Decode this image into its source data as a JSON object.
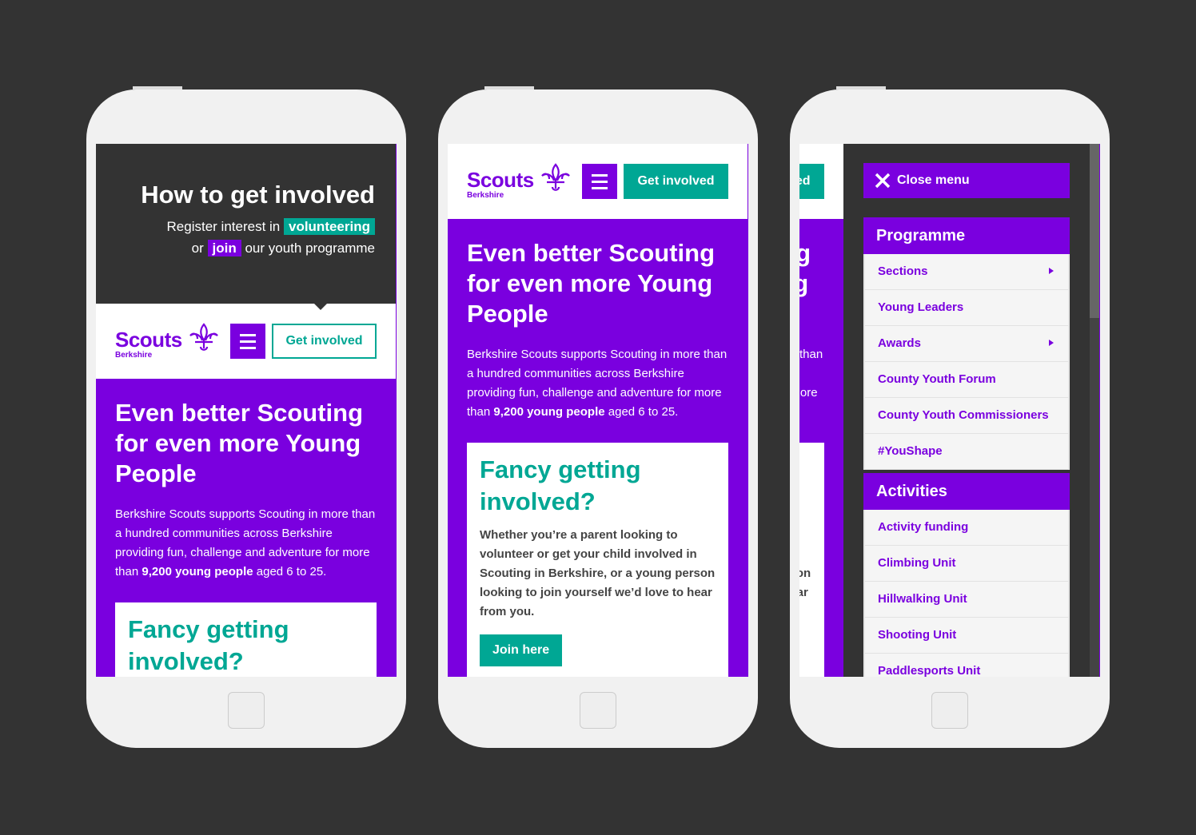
{
  "colors": {
    "purple": "#7a00df",
    "teal": "#00a794",
    "background": "#333333"
  },
  "intro": {
    "title": "How to get involved",
    "line1_prefix": "Register interest in",
    "volunteering": "volunteering",
    "or": "or",
    "join": "join",
    "line2_suffix": "our youth programme"
  },
  "header": {
    "logo_word": "Scouts",
    "logo_sub": "Berkshire",
    "logo_icon": "fleur-de-lis-icon",
    "menu_icon": "hamburger-icon",
    "cta": "Get involved"
  },
  "hero": {
    "title": "Even better Scouting for even more Young People",
    "text_before": "Berkshire Scouts supports Scouting in more than a hundred communities across Berkshire providing fun, challenge and adventure for more than ",
    "text_bold": "9,200 young people",
    "text_after": " aged 6 to 25."
  },
  "card": {
    "title": "Fancy getting involved?",
    "text": "Whether you’re a parent looking to volunteer or get your child involved in Scouting in Berkshire, or a young person looking to join yourself we’d love to hear from you.",
    "button": "Join here"
  },
  "menu": {
    "close": "Close menu",
    "sections": [
      {
        "title": "Programme",
        "items": [
          {
            "label": "Sections",
            "sub": true
          },
          {
            "label": "Young Leaders"
          },
          {
            "label": "Awards",
            "sub": true
          },
          {
            "label": "County Youth Forum"
          },
          {
            "label": "County Youth Commissioners"
          },
          {
            "label": "#YouShape"
          }
        ]
      },
      {
        "title": "Activities",
        "items": [
          {
            "label": "Activity funding"
          },
          {
            "label": "Climbing Unit"
          },
          {
            "label": "Hillwalking Unit"
          },
          {
            "label": "Shooting Unit"
          },
          {
            "label": "Paddlesports Unit"
          }
        ]
      }
    ]
  }
}
